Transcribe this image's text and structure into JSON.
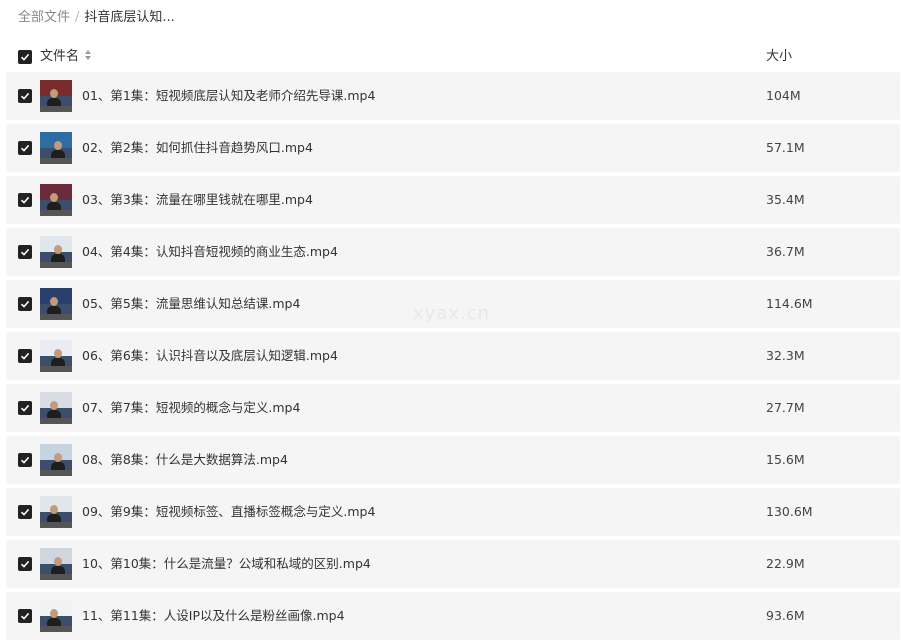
{
  "breadcrumb": {
    "root": "全部文件",
    "separator": "/",
    "current": "抖音底层认知..."
  },
  "header": {
    "name_label": "文件名",
    "size_label": "大小",
    "sort_icon": "sort-updown-icon",
    "select_all_checked": true
  },
  "files": [
    {
      "name": "01、第1集：短视频底层认知及老师介绍先导课.mp4",
      "size": "104M",
      "checked": true
    },
    {
      "name": "02、第2集：如何抓住抖音趋势风口.mp4",
      "size": "57.1M",
      "checked": true
    },
    {
      "name": "03、第3集：流量在哪里钱就在哪里.mp4",
      "size": "35.4M",
      "checked": true
    },
    {
      "name": "04、第4集：认知抖音短视频的商业生态.mp4",
      "size": "36.7M",
      "checked": true
    },
    {
      "name": "05、第5集：流量思维认知总结课.mp4",
      "size": "114.6M",
      "checked": true
    },
    {
      "name": "06、第6集：认识抖音以及底层认知逻辑.mp4",
      "size": "32.3M",
      "checked": true
    },
    {
      "name": "07、第7集：短视频的概念与定义.mp4",
      "size": "27.7M",
      "checked": true
    },
    {
      "name": "08、第8集：什么是大数据算法.mp4",
      "size": "15.6M",
      "checked": true
    },
    {
      "name": "09、第9集：短视频标签、直播标签概念与定义.mp4",
      "size": "130.6M",
      "checked": true
    },
    {
      "name": "10、第10集：什么是流量？公域和私域的区别.mp4",
      "size": "22.9M",
      "checked": true
    },
    {
      "name": "11、第11集：人设IP以及什么是粉丝画像.mp4",
      "size": "93.6M",
      "checked": true
    }
  ],
  "watermark": "xyax.cn",
  "colors": {
    "row_bg": "#f5f5f5",
    "checkbox": "#222222",
    "text": "#333333",
    "breadcrumb_muted": "#888888",
    "watermark": "#e8e8e8"
  }
}
